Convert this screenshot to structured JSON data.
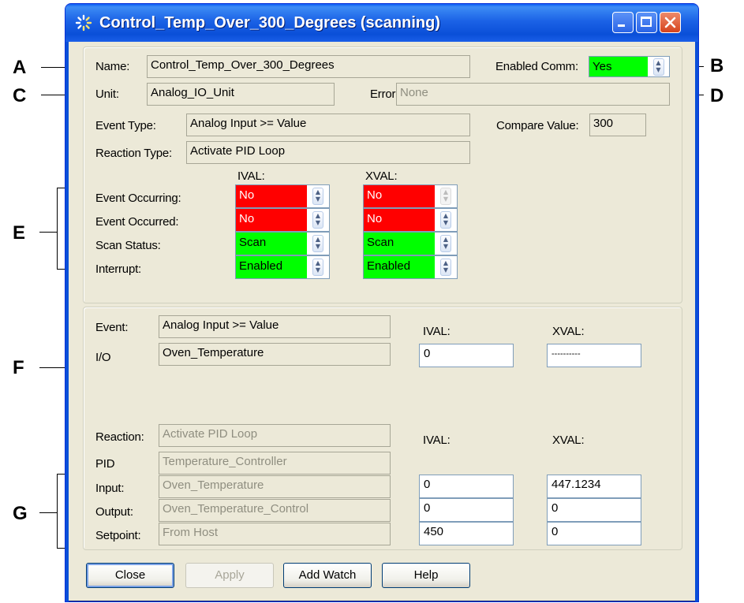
{
  "window": {
    "title": "Control_Temp_Over_300_Degrees (scanning)",
    "icon": "spinner-icon",
    "controls": [
      "minimize-icon",
      "maximize-icon",
      "close-icon"
    ]
  },
  "annotations": {
    "A": "A",
    "B": "B",
    "C": "C",
    "D": "D",
    "E": "E",
    "F": "F",
    "G": "G"
  },
  "header": {
    "name_label": "Name:",
    "name_value": "Control_Temp_Over_300_Degrees",
    "enabled_comm_label": "Enabled Comm:",
    "enabled_comm_value": "Yes",
    "unit_label": "Unit:",
    "unit_value": "Analog_IO_Unit",
    "error_label": "Error:",
    "error_value": "None",
    "event_type_label": "Event Type:",
    "event_type_value": "Analog Input >= Value",
    "compare_value_label": "Compare Value:",
    "compare_value": "300",
    "reaction_type_label": "Reaction Type:",
    "reaction_type_value": "Activate PID Loop"
  },
  "status_grid": {
    "ival_header": "IVAL:",
    "xval_header": "XVAL:",
    "rows": [
      {
        "label": "Event Occurring:",
        "ival": "No",
        "xval": "No",
        "ival_color": "#ff0000",
        "xval_color": "#ff0000"
      },
      {
        "label": "Event Occurred:",
        "ival": "No",
        "xval": "No",
        "ival_color": "#ff0000",
        "xval_color": "#ff0000"
      },
      {
        "label": "Scan Status:",
        "ival": "Scan",
        "xval": "Scan",
        "ival_color": "#00ff00",
        "xval_color": "#00ff00"
      },
      {
        "label": "Interrupt:",
        "ival": "Enabled",
        "xval": "Enabled",
        "ival_color": "#00ff00",
        "xval_color": "#00ff00"
      }
    ]
  },
  "event_section": {
    "event_label": "Event:",
    "event_value": "Analog Input >= Value",
    "io_label": "I/O",
    "io_value": "Oven_Temperature",
    "ival_header": "IVAL:",
    "xval_header": "XVAL:",
    "io_ival": "0",
    "io_xval": "----------"
  },
  "reaction_section": {
    "reaction_label": "Reaction:",
    "reaction_value": "Activate PID Loop",
    "pid_label": "PID",
    "pid_value": "Temperature_Controller",
    "ival_header": "IVAL:",
    "xval_header": "XVAL:",
    "rows": [
      {
        "label": "Input:",
        "value": "Oven_Temperature",
        "ival": "0",
        "xval": "447.1234"
      },
      {
        "label": "Output:",
        "value": "Oven_Temperature_Control",
        "ival": "0",
        "xval": "0"
      },
      {
        "label": "Setpoint:",
        "value": "From Host",
        "ival": "450",
        "xval": "0"
      }
    ]
  },
  "buttons": {
    "close": "Close",
    "apply": "Apply",
    "add_watch": "Add Watch",
    "help": "Help"
  },
  "colors": {
    "title_bar": "#0a4fd8",
    "status_red": "#ff0000",
    "status_green": "#00ff00",
    "dialog_bg": "#ece9d8"
  }
}
